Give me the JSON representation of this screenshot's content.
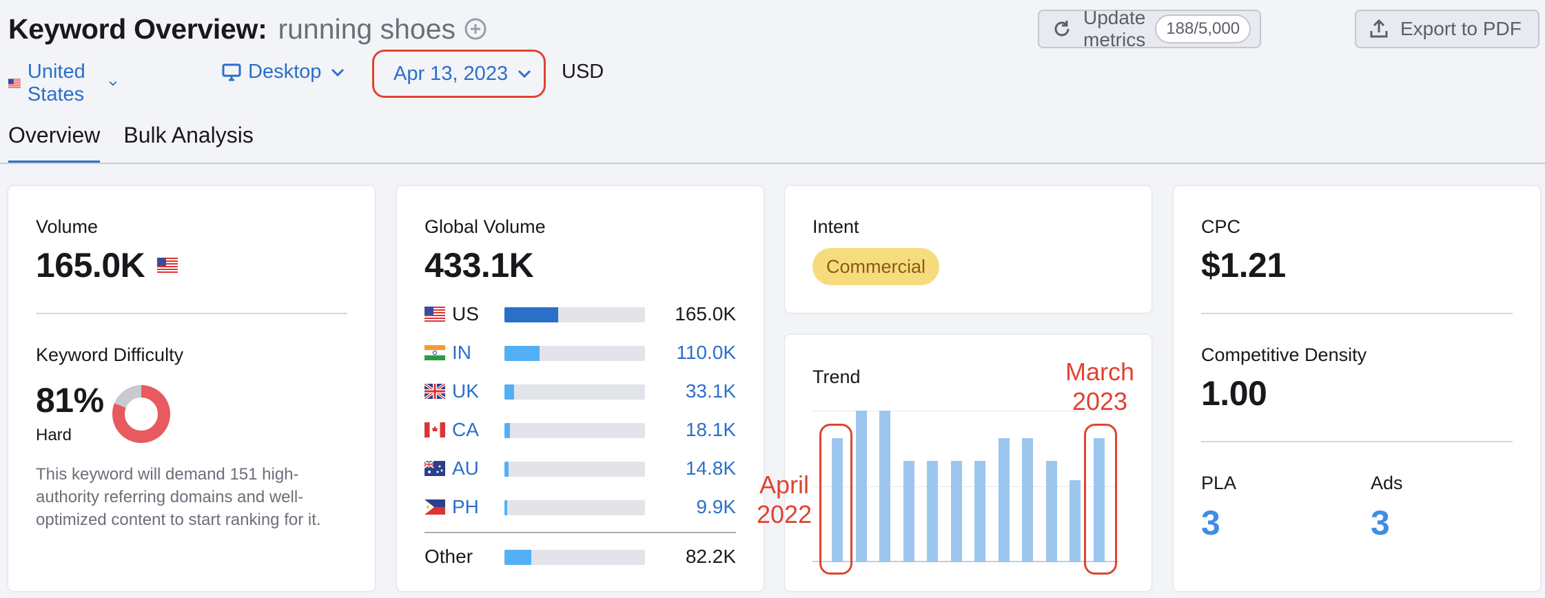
{
  "header": {
    "title": "Keyword Overview:",
    "keyword": "running shoes",
    "update_label": "Update metrics",
    "update_count": "188/5,000",
    "export_label": "Export to PDF"
  },
  "filters": {
    "country": "United States",
    "device": "Desktop",
    "date": "Apr 13, 2023",
    "currency": "USD"
  },
  "tabs": [
    {
      "label": "Overview",
      "active": true
    },
    {
      "label": "Bulk Analysis",
      "active": false
    }
  ],
  "volume": {
    "label": "Volume",
    "value": "165.0K",
    "kd_label": "Keyword Difficulty",
    "kd_value": "81%",
    "kd_level": "Hard",
    "kd_percent": 81,
    "description": "This keyword will demand 151 high-authority referring domains and well-optimized content to start ranking for it."
  },
  "global": {
    "label": "Global Volume",
    "value": "433.1K",
    "countries": [
      {
        "code": "US",
        "value": "165.0K",
        "share": 0.38,
        "link": false
      },
      {
        "code": "IN",
        "value": "110.0K",
        "share": 0.25,
        "link": true
      },
      {
        "code": "UK",
        "value": "33.1K",
        "share": 0.07,
        "link": true
      },
      {
        "code": "CA",
        "value": "18.1K",
        "share": 0.04,
        "link": true
      },
      {
        "code": "AU",
        "value": "14.8K",
        "share": 0.03,
        "link": true
      },
      {
        "code": "PH",
        "value": "9.9K",
        "share": 0.02,
        "link": true
      }
    ],
    "other_label": "Other",
    "other_value": "82.2K",
    "other_share": 0.19
  },
  "intent": {
    "label": "Intent",
    "badge": "Commercial"
  },
  "trend": {
    "label": "Trend",
    "annotation_left": "April 2022",
    "annotation_right": "March 2023",
    "values": [
      0.82,
      1.0,
      1.0,
      0.67,
      0.67,
      0.67,
      0.67,
      0.82,
      0.82,
      0.67,
      0.54,
      0.82
    ]
  },
  "cpc": {
    "label": "CPC",
    "value": "$1.21",
    "cd_label": "Competitive Density",
    "cd_value": "1.00",
    "pla_label": "PLA",
    "pla_value": "3",
    "ads_label": "Ads",
    "ads_value": "3"
  },
  "colors": {
    "accent": "#2a6fc8",
    "bar_us": "#2a6fc8",
    "bar_other": "#54b0f5",
    "trend_bar": "#9cc6ee",
    "kd_red": "#e85a5f",
    "annotation": "#e0432f"
  }
}
